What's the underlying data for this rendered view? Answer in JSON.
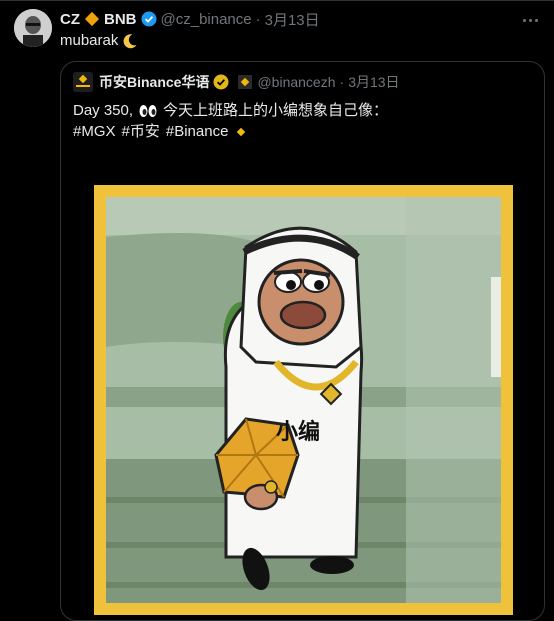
{
  "tweet": {
    "author_name": "CZ",
    "author_suffix": "BNB",
    "handle": "@cz_binance",
    "dot": "·",
    "date": "3月13日",
    "text": "mubarak"
  },
  "quoted": {
    "author_name": "币安Binance华语",
    "handle": "@binancezh",
    "dot": "·",
    "date": "3月13日",
    "line1_prefix": "Day 350,",
    "line1_rest": "今天上班路上的小编想象自己像：",
    "hashtags": [
      "#MGX",
      "#币安",
      "#Binance"
    ],
    "image_caption": "小编"
  },
  "colors": {
    "background": "#000000",
    "text": "#e7e9ea",
    "muted": "#71767b",
    "verified_blue": "#1d9bf0",
    "binance_gold": "#f0b90b",
    "frame_yellow": "#f0c23b"
  },
  "icons": {
    "more": "more-horizontal-icon",
    "verified": "verified-badge-icon",
    "gold_verified": "gold-verified-badge-icon",
    "bnb": "bnb-diamond-icon",
    "moon": "crescent-moon-icon",
    "eyes": "eyes-emoji-icon"
  }
}
